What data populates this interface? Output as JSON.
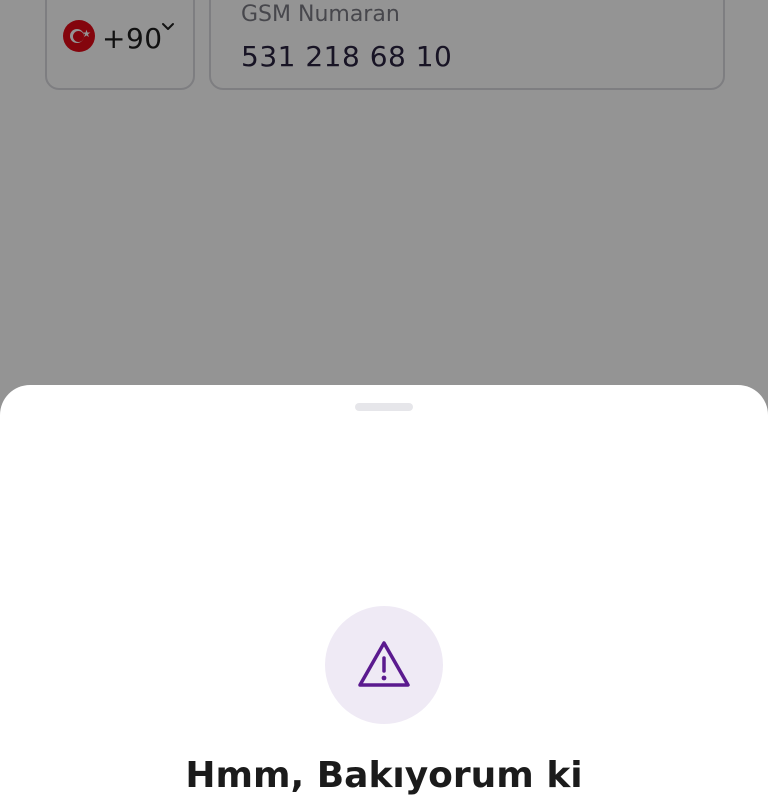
{
  "form": {
    "country_code": "+90",
    "country_flag": "turkey-flag-icon",
    "phone_label": "GSM Numaran",
    "phone_value": "531 218 68 10"
  },
  "sheet": {
    "icon": "warning-triangle-icon",
    "title": "Hmm, Bakıyorum ki"
  },
  "colors": {
    "accent": "#5b1a8f",
    "icon_bg": "#efeaf5",
    "scrim": "rgba(0,0,0,0.42)"
  }
}
